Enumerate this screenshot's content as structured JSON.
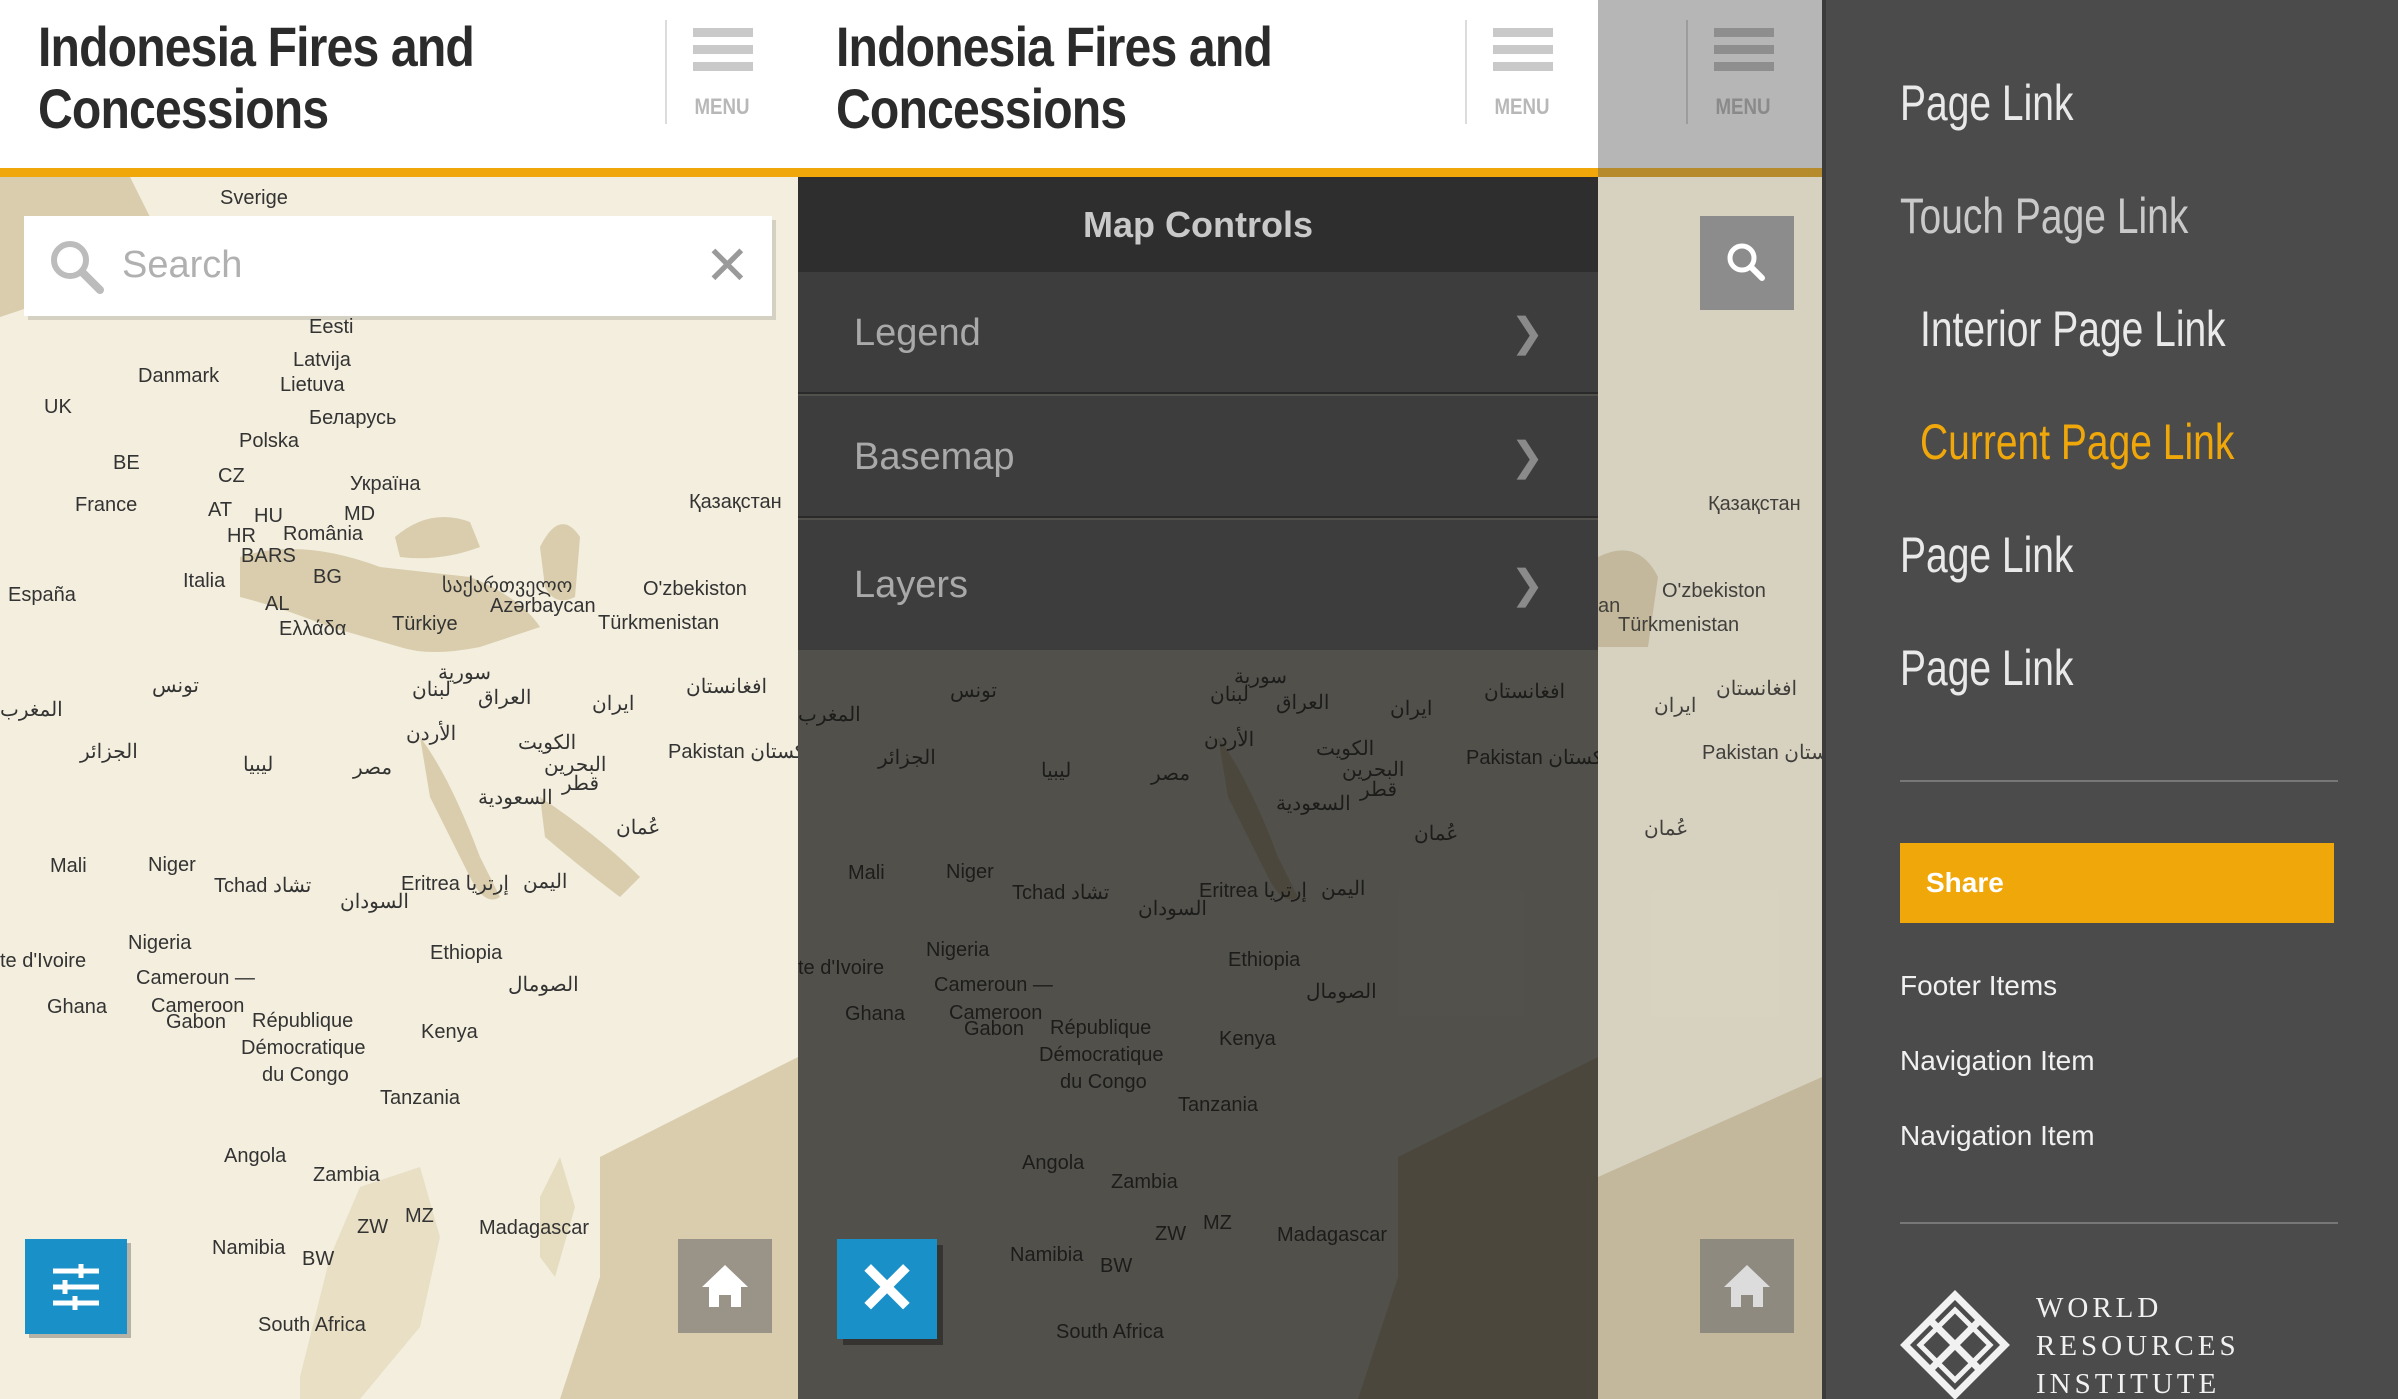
{
  "app": {
    "title_line1": "Indonesia Fires and",
    "title_line2": "Concessions",
    "menu_label": "MENU"
  },
  "search": {
    "placeholder": "Search"
  },
  "map_labels": [
    "Sverige",
    "Eesti",
    "Latvija",
    "Lietuva",
    "Danmark",
    "UK",
    "Беларусь",
    "Polska",
    "BE",
    "CZ",
    "Україна",
    "France",
    "AT",
    "HU",
    "MD",
    "HR",
    "România",
    "BA",
    "RS",
    "Italia",
    "BG",
    "España",
    "AL",
    "Ελλάδα",
    "Türkiye",
    "საქართველო",
    "Azərbaycan",
    "Қазақстан",
    "O'zbekiston",
    "Türkmenistan",
    "سورية",
    "لبنان",
    "العراق",
    "ایران",
    "افغانستان",
    "الأردن",
    "تونس",
    "المغرب",
    "الجزائر",
    "ليبيا",
    "مصر",
    "الكويت",
    "البحرين",
    "قطر",
    "السعودية",
    "Pakistan پاکستان",
    "عُمان",
    "Mali",
    "Niger",
    "Tchad تشاد",
    "Eritrea إرتريا",
    "اليمن",
    "السودان",
    "Nigeria",
    "Cameroun —",
    "Cameroon",
    "Ethiopia",
    "الصومال",
    "Ghana",
    "Gabon",
    "République",
    "Démocratique",
    "du Congo",
    "Kenya",
    "Tanzania",
    "Angola",
    "Zambia",
    "ZW",
    "MZ",
    "Madagascar",
    "Namibia",
    "BW",
    "South Africa",
    "te d'Ivoire"
  ],
  "map_controls": {
    "title": "Map Controls",
    "items": [
      {
        "label": "Legend"
      },
      {
        "label": "Basemap"
      },
      {
        "label": "Layers"
      }
    ]
  },
  "nav": {
    "links": [
      {
        "label": "Page Link",
        "state": "normal"
      },
      {
        "label": "Touch Page Link",
        "state": "touch"
      },
      {
        "label": "Interior Page Link",
        "state": "interior"
      },
      {
        "label": "Current Page Link",
        "state": "current"
      },
      {
        "label": "Page Link",
        "state": "normal"
      },
      {
        "label": "Page Link",
        "state": "normal"
      }
    ],
    "share_label": "Share",
    "footer_items": [
      {
        "label": "Footer Items"
      },
      {
        "label": "Navigation Item"
      },
      {
        "label": "Navigation Item"
      }
    ],
    "brand": {
      "line1": "WORLD",
      "line2": "RESOURCES",
      "line3": "INSTITUTE"
    }
  },
  "colors": {
    "accent": "#f0a70a",
    "button_blue": "#1a90c8",
    "drawer_bg": "#4b4b4b",
    "map_land": "#ede5cf",
    "map_water": "#d8cbab"
  },
  "icons": {
    "search": "search-icon",
    "clear": "close-icon",
    "menu": "hamburger-icon",
    "controls": "sliders-icon",
    "home": "home-icon",
    "chevron": "chevron-right-icon",
    "close": "close-icon"
  }
}
